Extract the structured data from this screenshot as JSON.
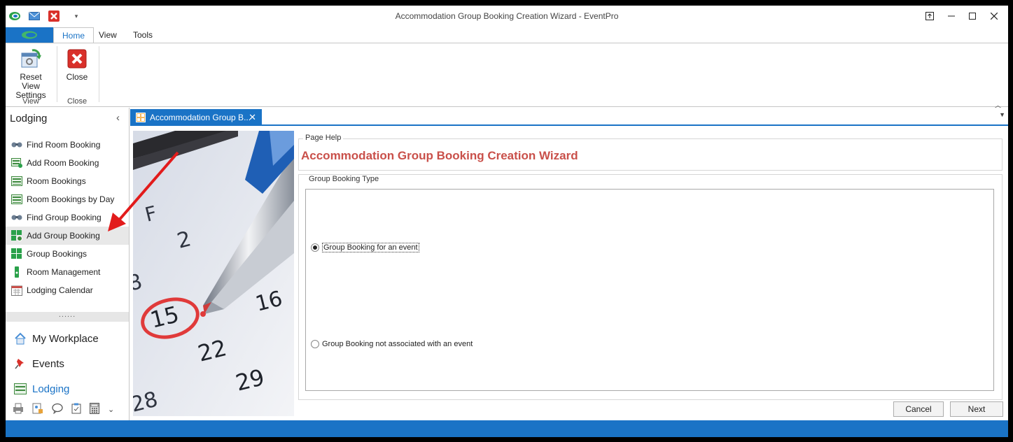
{
  "window": {
    "title": "Accommodation Group Booking Creation Wizard - EventPro"
  },
  "ribbon": {
    "tabs": [
      "Home",
      "View",
      "Tools"
    ],
    "active_tab": "Home",
    "buttons": [
      {
        "label_line1": "Reset View",
        "label_line2": "Settings",
        "icon": "reset-view-icon",
        "group": "View"
      },
      {
        "label_line1": "Close",
        "label_line2": "",
        "icon": "close-red-icon",
        "group": "Close"
      }
    ],
    "groups": [
      "View",
      "Close"
    ]
  },
  "sidebar": {
    "header": "Lodging",
    "items": [
      {
        "label": "Find Room Booking",
        "icon": "binoculars-icon"
      },
      {
        "label": "Add Room Booking",
        "icon": "add-room-booking-icon"
      },
      {
        "label": "Room Bookings",
        "icon": "room-bookings-icon"
      },
      {
        "label": "Room Bookings by Day",
        "icon": "room-bookings-day-icon"
      },
      {
        "label": "Find Group Booking",
        "icon": "binoculars-icon"
      },
      {
        "label": "Add Group Booking",
        "icon": "add-group-booking-icon",
        "selected": true
      },
      {
        "label": "Group Bookings",
        "icon": "group-bookings-icon"
      },
      {
        "label": "Room Management",
        "icon": "room-management-icon"
      },
      {
        "label": "Lodging Calendar",
        "icon": "calendar-icon"
      }
    ],
    "modules": [
      {
        "label": "My Workplace",
        "icon": "home-icon"
      },
      {
        "label": "Events",
        "icon": "pin-icon"
      },
      {
        "label": "Lodging",
        "icon": "lodging-icon",
        "active": true
      }
    ],
    "grip": "......"
  },
  "document_tab": {
    "label": "Accommodation Group B..."
  },
  "wizard": {
    "help_legend": "Page Help",
    "title": "Accommodation Group Booking Creation Wizard",
    "type_legend": "Group Booking Type",
    "options": [
      {
        "label": "Group Booking for an event",
        "checked": true
      },
      {
        "label": "Group Booking not associated with an event",
        "checked": false
      }
    ],
    "cancel_label": "Cancel",
    "next_label": "Next"
  },
  "colors": {
    "accent": "#1a73c6",
    "title_red": "#c9504a",
    "arrow_red": "#e21b1b"
  }
}
